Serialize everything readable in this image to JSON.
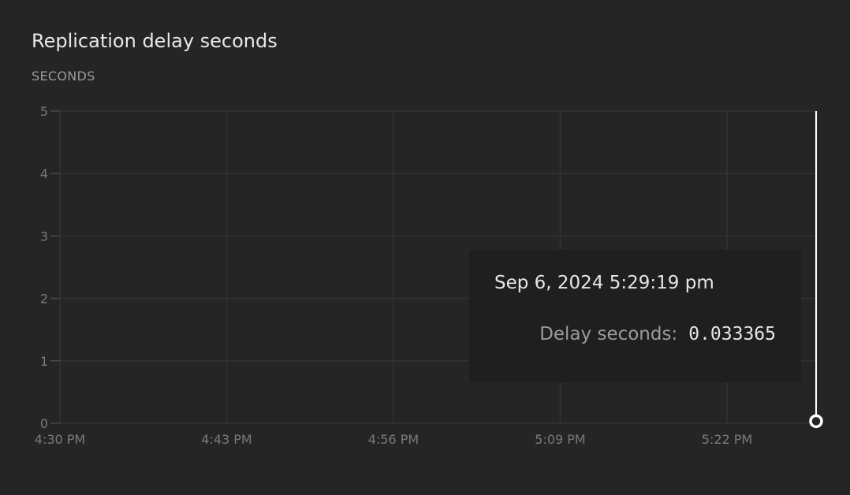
{
  "panel": {
    "title": "Replication delay seconds",
    "unit_label": "SECONDS"
  },
  "chart_data": {
    "type": "line",
    "title": "Replication delay seconds",
    "ylabel": "SECONDS",
    "ylim": [
      0,
      5
    ],
    "y_ticks": [
      "0",
      "1",
      "2",
      "3",
      "4",
      "5"
    ],
    "x_ticks": [
      "4:30 PM",
      "4:43 PM",
      "4:56 PM",
      "5:09 PM",
      "5:22 PM"
    ],
    "x_range": [
      "4:30 PM",
      "5:29 PM"
    ],
    "grid": true,
    "series": [
      {
        "name": "Delay seconds",
        "x": [
          "5:29:19 PM"
        ],
        "values": [
          0.033365
        ]
      }
    ],
    "colors": {
      "background": "#252525",
      "grid": "#333333",
      "axis": "#4a4a4a",
      "line": "#ffffff"
    }
  },
  "tooltip": {
    "timestamp": "Sep 6, 2024 5:29:19 pm",
    "label": "Delay seconds:",
    "value": "0.033365"
  }
}
